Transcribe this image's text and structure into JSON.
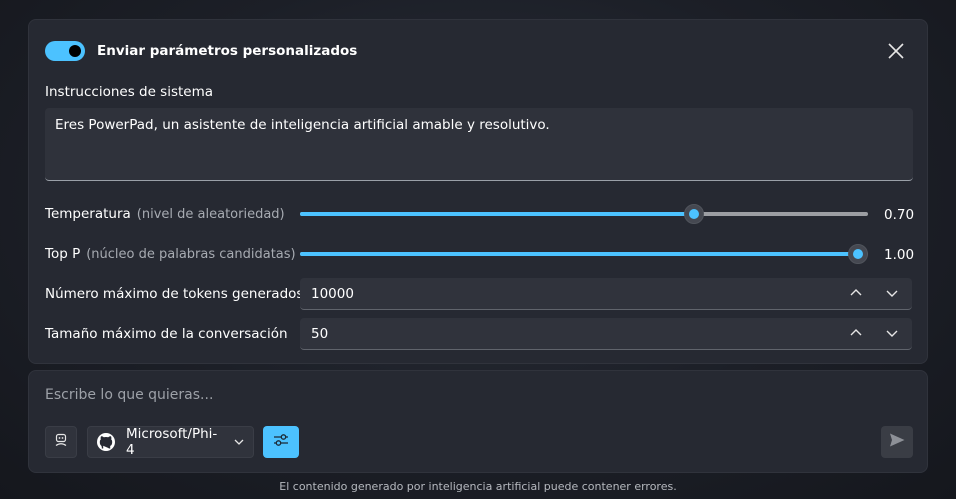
{
  "settings": {
    "toggle_label": "Enviar parámetros personalizados",
    "toggle_on": true,
    "system_label": "Instrucciones de sistema",
    "system_value": "Eres PowerPad, un asistente de inteligencia artificial amable y resolutivo.",
    "temperature": {
      "label": "Temperatura",
      "hint": "(nivel de aleatoriedad)",
      "value": 0.7,
      "value_text": "0.70"
    },
    "top_p": {
      "label": "Top P",
      "hint": "(núcleo de palabras candidatas)",
      "value": 1.0,
      "value_text": "1.00"
    },
    "max_tokens": {
      "label": "Número máximo de tokens generados",
      "value": "10000"
    },
    "max_conversation": {
      "label": "Tamaño máximo de la conversación",
      "value": "50"
    }
  },
  "chat": {
    "placeholder": "Escribe lo que quieras...",
    "model_name": "Microsoft/Phi-4"
  },
  "footer_text": "El contenido generado por inteligencia artificial puede contener errores.",
  "colors": {
    "accent": "#4cc2ff",
    "panel": "#262932"
  },
  "icons": {
    "close": "close-icon",
    "agent": "agent-icon",
    "model": "github-icon",
    "settings": "sliders-icon",
    "send": "send-icon"
  }
}
